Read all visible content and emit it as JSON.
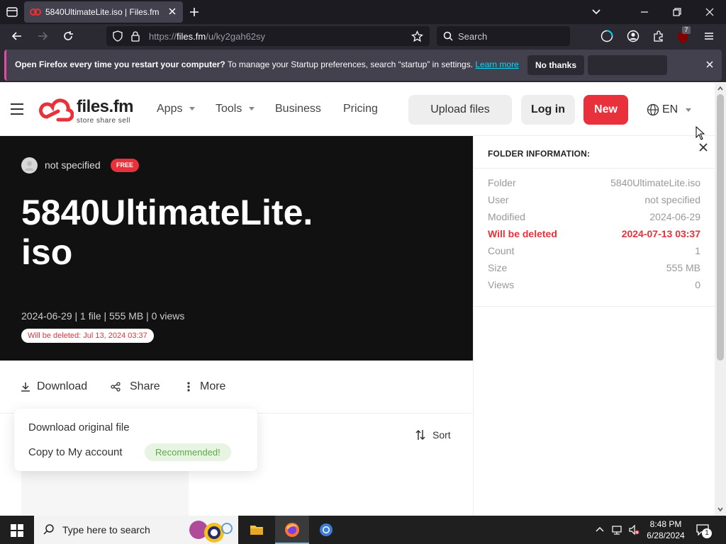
{
  "browser": {
    "tab_title": "5840UltimateLite.iso | Files.fm",
    "url_prefix": "https://",
    "url_domain": "files.fm",
    "url_path": "/u/ky2gah62sy",
    "search_placeholder": "Search",
    "extension_badge": "7"
  },
  "notification": {
    "bold_text": "Open Firefox every time you restart your computer?",
    "text": " To manage your Startup preferences, search “startup” in settings. ",
    "link": "Learn more",
    "no_thanks": "No thanks"
  },
  "site_header": {
    "logo_name": "files.fm",
    "logo_tagline": "store  share  sell",
    "menu": [
      "Apps",
      "Tools",
      "Business",
      "Pricing"
    ],
    "upload_label": "Upload files",
    "login_label": "Log in",
    "new_label": "New",
    "language": "EN"
  },
  "hero": {
    "owner": "not specified",
    "plan_badge": "FREE",
    "title": "5840UltimateLite.\niso",
    "meta": "2024-06-29 | 1 file | 555 MB | 0 views",
    "delete_badge": "Will be deleted: Jul 13, 2024 03:37"
  },
  "actions": {
    "download": "Download",
    "share": "Share",
    "more": "More",
    "sort": "Sort"
  },
  "download_menu": {
    "items": [
      "Download original file",
      "Copy to My account"
    ],
    "recommended": "Recommended!"
  },
  "folder_info": {
    "title": "FOLDER INFORMATION:",
    "rows": [
      {
        "key": "Folder",
        "value": "5840UltimateLite.iso"
      },
      {
        "key": "User",
        "value": "not specified"
      },
      {
        "key": "Modified",
        "value": "2024-06-29"
      },
      {
        "key": "Will be deleted",
        "value": "2024-07-13 03:37"
      },
      {
        "key": "Count",
        "value": "1"
      },
      {
        "key": "Size",
        "value": "555 MB"
      },
      {
        "key": "Views",
        "value": "0"
      }
    ]
  },
  "taskbar": {
    "search_placeholder": "Type here to search",
    "time": "8:48 PM",
    "date": "6/28/2024",
    "notification_count": "1"
  },
  "colors": {
    "brand_red": "#e8313a",
    "chrome_dark": "#1c1b22",
    "notif_accent": "#e34ca3",
    "link_cyan": "#00ddff"
  }
}
